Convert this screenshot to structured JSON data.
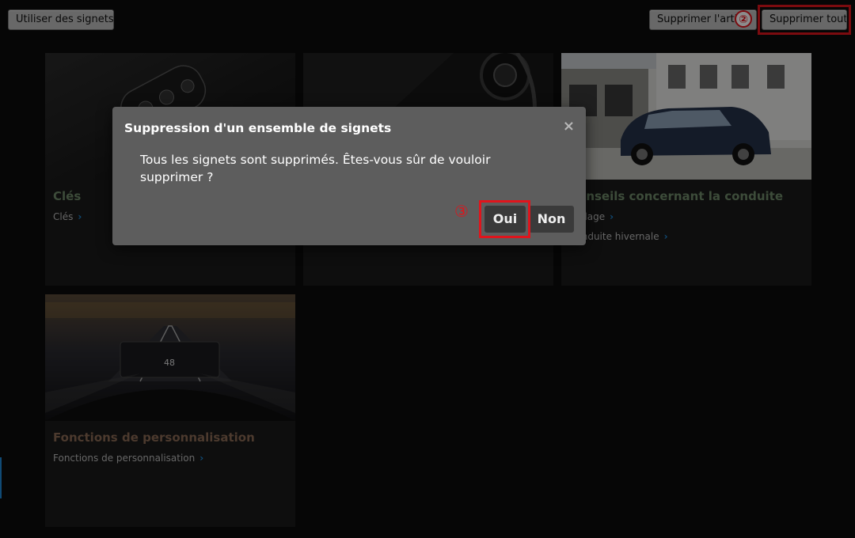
{
  "toolbar": {
    "use_bookmarks": "Utiliser des signets",
    "delete_item": "Supprimer l'article",
    "delete_all": "Supprimer tout",
    "step2": "②"
  },
  "cards": [
    {
      "title": "Clés",
      "links": [
        "Clés"
      ],
      "title_color": "#6f8a6a"
    },
    {
      "title": "",
      "links": []
    },
    {
      "title": "Conseils concernant la conduite",
      "links": [
        "Rodage",
        "Conduite hivernale"
      ],
      "title_color": "#6f8a6a"
    },
    {
      "title": "Fonctions de personnalisation",
      "links": [
        "Fonctions de personnalisation"
      ],
      "title_color": "#8a6a55"
    }
  ],
  "dialog": {
    "title": "Suppression d'un ensemble de signets",
    "message": "Tous les signets sont supprimés. Êtes-vous sûr de vouloir supprimer ?",
    "yes": "Oui",
    "no": "Non",
    "step3": "③"
  },
  "hud": {
    "speed": "48"
  },
  "colors": {
    "highlight": "#e0141c",
    "link_chevron": "#1e88d6"
  }
}
